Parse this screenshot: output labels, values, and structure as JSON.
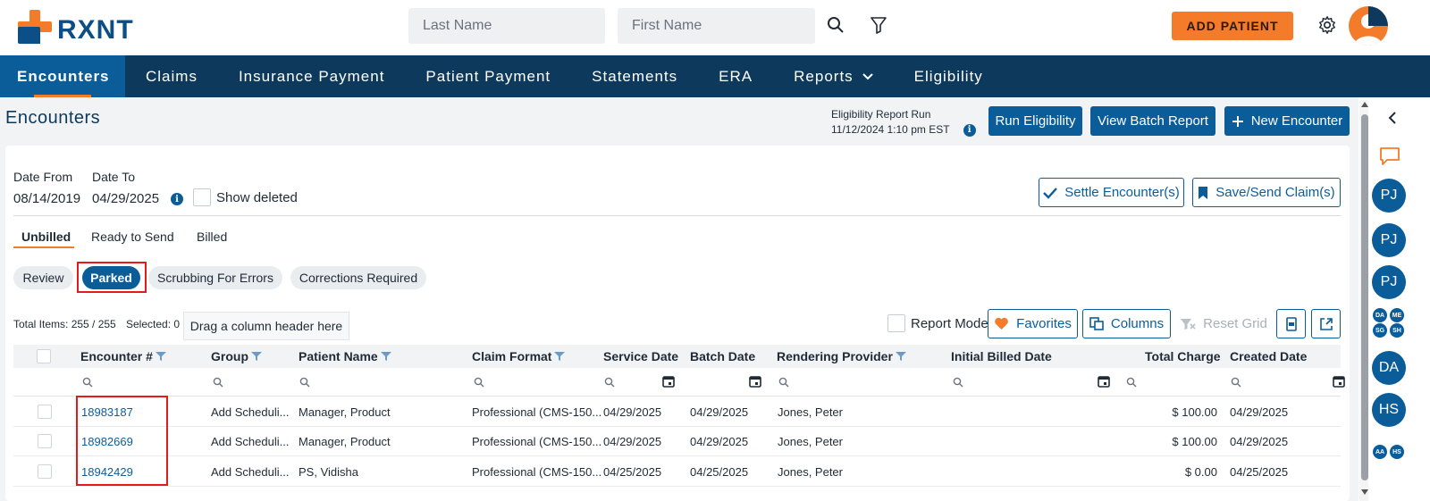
{
  "brand": {
    "logo_text": "RXNT",
    "orange": "#f47b2a",
    "navy": "#0d3a5c",
    "blue": "#0b5d9a"
  },
  "search": {
    "last_name_placeholder": "Last Name",
    "first_name_placeholder": "First Name"
  },
  "header": {
    "add_patient_label": "ADD PATIENT"
  },
  "nav": {
    "items": [
      {
        "label": "Encounters",
        "active": true
      },
      {
        "label": "Claims"
      },
      {
        "label": "Insurance Payment"
      },
      {
        "label": "Patient Payment"
      },
      {
        "label": "Statements"
      },
      {
        "label": "ERA"
      },
      {
        "label": "Reports"
      },
      {
        "label": "Eligibility"
      }
    ]
  },
  "page": {
    "title": "Encounters",
    "eligibility_run_label": "Eligibility Report Run",
    "eligibility_run_time": "11/12/2024 1:10 pm EST",
    "run_eligibility_label": "Run Eligibility",
    "view_batch_report_label": "View Batch Report",
    "new_encounter_label": "New Encounter"
  },
  "filters": {
    "date_from_label": "Date From",
    "date_from_value": "08/14/2019",
    "date_to_label": "Date To",
    "date_to_value": "04/29/2025",
    "show_deleted_label": "Show deleted",
    "settle_label": "Settle Encounter(s)",
    "save_send_label": "Save/Send Claim(s)"
  },
  "tabs": [
    {
      "label": "Unbilled",
      "active": true
    },
    {
      "label": "Ready to Send"
    },
    {
      "label": "Billed"
    }
  ],
  "chips": [
    {
      "label": "Review"
    },
    {
      "label": "Parked",
      "active": true
    },
    {
      "label": "Scrubbing For Errors"
    },
    {
      "label": "Corrections Required"
    }
  ],
  "grid_toolbar": {
    "total_items": "Total Items: 255 / 255",
    "selected": "Selected: 0",
    "drag_hint": "Drag a column header here",
    "report_mode_label": "Report Mode",
    "favorites_label": "Favorites",
    "columns_label": "Columns",
    "reset_grid_label": "Reset Grid"
  },
  "grid": {
    "columns": [
      "Encounter #",
      "Group",
      "Patient Name",
      "Claim Format",
      "Service Date",
      "Batch Date",
      "Rendering Provider",
      "Initial Billed Date",
      "Total Charge",
      "Created Date"
    ],
    "rows": [
      [
        "18983187",
        "Add Scheduli...",
        "Manager, Product",
        "Professional (CMS-150...",
        "04/29/2025",
        "04/29/2025",
        "Jones, Peter",
        "",
        "$ 100.00",
        "04/29/2025"
      ],
      [
        "18982669",
        "Add Scheduli...",
        "Manager, Product",
        "Professional (CMS-150...",
        "04/29/2025",
        "04/29/2025",
        "Jones, Peter",
        "",
        "$ 100.00",
        "04/29/2025"
      ],
      [
        "18942429",
        "Add Scheduli...",
        "PS, Vidisha",
        "Professional (CMS-150...",
        "04/25/2025",
        "04/25/2025",
        "Jones, Peter",
        "",
        "$ 0.00",
        "04/25/2025"
      ]
    ]
  },
  "rail": {
    "avatars": [
      "PJ",
      "PJ",
      "PJ",
      "DA",
      "HS"
    ],
    "mini_group_1": [
      "DA",
      "ME",
      "SG",
      "SH"
    ],
    "mini_group_2": [
      "AA",
      "HS"
    ]
  }
}
